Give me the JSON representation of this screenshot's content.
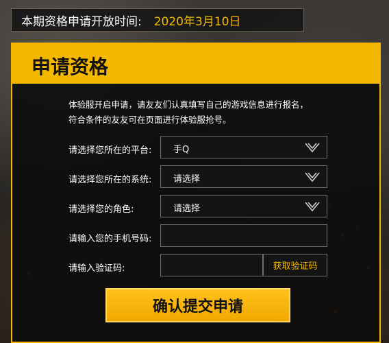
{
  "banner": {
    "label": "本期资格申请开放时间:",
    "date": "2020年3月10日"
  },
  "panel": {
    "title": "申请资格",
    "intro_line1": "体验服开启申请，请友友们认真填写自己的游戏信息进行报名，",
    "intro_line2": "符合条件的友友可在页面进行体验服抢号。"
  },
  "form": {
    "platform": {
      "label": "请选择您所在的平台:",
      "value": "手Q"
    },
    "system": {
      "label": "请选择您所在的系统:",
      "value": "请选择"
    },
    "role": {
      "label": "请选择您的角色:",
      "value": "请选择"
    },
    "phone": {
      "label": "请输入您的手机号码:",
      "value": ""
    },
    "code": {
      "label": "请输入验证码:",
      "value": "",
      "button": "获取验证码"
    },
    "submit": "确认提交申请"
  },
  "colors": {
    "accent": "#f5b800",
    "panel_bg": "#0c0c0c",
    "field_border": "#6f6f6f"
  },
  "icons": {
    "dropdown": "chevron-down-icon"
  }
}
